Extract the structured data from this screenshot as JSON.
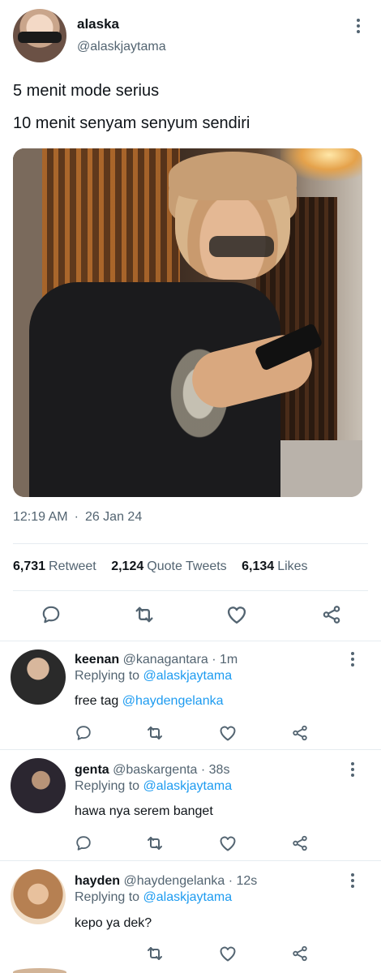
{
  "main_tweet": {
    "author_name": "alaska",
    "author_handle": "@alaskjaytama",
    "text_lines": [
      "5 menit mode serius",
      "10 menit senyam senyum sendiri"
    ],
    "time": "12:19 AM",
    "date": "26 Jan 24",
    "stats": {
      "retweets_count": "6,731",
      "retweets_label": "Retweet",
      "quotes_count": "2,124",
      "quotes_label": "Quote Tweets",
      "likes_count": "6,134",
      "likes_label": "Likes"
    }
  },
  "replies": [
    {
      "name": "keenan",
      "handle": "@kanagantara",
      "time": "1m",
      "replying_prefix": "Replying to",
      "replying_to": "@alaskjaytama",
      "text": "free tag",
      "text_mention": "@haydengelanka"
    },
    {
      "name": "genta",
      "handle": "@baskargenta",
      "time": "38s",
      "replying_prefix": "Replying to",
      "replying_to": "@alaskjaytama",
      "text": "hawa nya serem banget",
      "text_mention": ""
    },
    {
      "name": "hayden",
      "handle": "@haydengelanka",
      "time": "12s",
      "replying_prefix": "Replying to",
      "replying_to": "@alaskjaytama",
      "text": "kepo ya dek?",
      "text_mention": ""
    }
  ],
  "icons": {
    "reply": "reply-icon",
    "retweet": "retweet-icon",
    "like": "heart-icon",
    "share": "share-icon",
    "more": "more-icon"
  },
  "colors": {
    "text_primary": "#0f1419",
    "text_secondary": "#536471",
    "mention": "#1d9bf0",
    "divider": "#e6ecf0"
  }
}
